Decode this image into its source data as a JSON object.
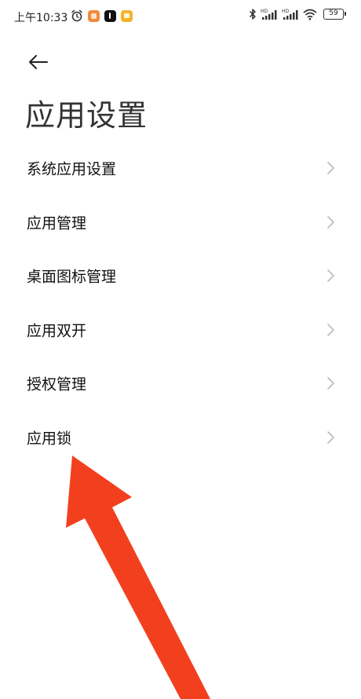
{
  "status_bar": {
    "time": "上午10:33",
    "battery": "59",
    "icons": [
      "alarm-icon",
      "app-badge-orange",
      "tiktok-icon",
      "app-badge-yellow",
      "bluetooth-icon",
      "hd-signal-icon",
      "hd-signal-icon",
      "wifi-icon",
      "battery-icon"
    ]
  },
  "header": {
    "back_icon": "arrow-left-icon",
    "title": "应用设置"
  },
  "settings": {
    "items": [
      {
        "label": "系统应用设置"
      },
      {
        "label": "应用管理"
      },
      {
        "label": "桌面图标管理"
      },
      {
        "label": "应用双开"
      },
      {
        "label": "授权管理"
      },
      {
        "label": "应用锁"
      }
    ]
  },
  "annotation": {
    "arrow_color": "#f2401f"
  }
}
